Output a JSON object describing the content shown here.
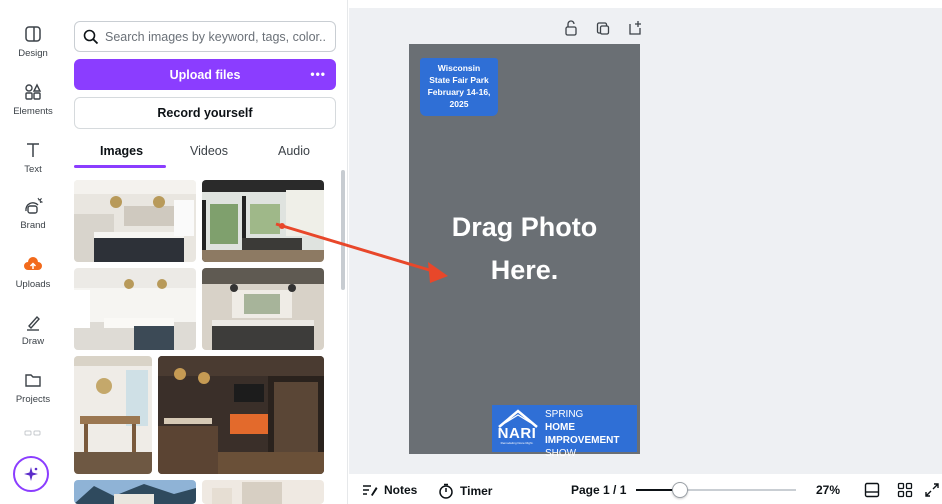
{
  "rail": {
    "items": [
      {
        "label": "Design",
        "icon": "design-icon"
      },
      {
        "label": "Elements",
        "icon": "elements-icon"
      },
      {
        "label": "Text",
        "icon": "text-icon"
      },
      {
        "label": "Brand",
        "icon": "brand-icon"
      },
      {
        "label": "Uploads",
        "icon": "uploads-icon"
      },
      {
        "label": "Draw",
        "icon": "draw-icon"
      },
      {
        "label": "Projects",
        "icon": "projects-icon"
      }
    ]
  },
  "panel": {
    "search_placeholder": "Search images by keyword, tags, color...",
    "upload_label": "Upload files",
    "upload_more": "•••",
    "record_label": "Record yourself",
    "tabs": [
      {
        "label": "Images",
        "active": true
      },
      {
        "label": "Videos",
        "active": false
      },
      {
        "label": "Audio",
        "active": false
      }
    ]
  },
  "canvas": {
    "badge_lines": [
      "Wisconsin",
      "State Fair Park",
      "February 14-16,",
      "2025"
    ],
    "placeholder_lines": [
      "Drag Photo",
      "Here."
    ],
    "logo_word": "NARI",
    "logo_sub": "Remodeling Done Right.",
    "show_lines": [
      {
        "light": "SPRING ",
        "bold": "HOME"
      },
      {
        "light": "",
        "bold": "IMPROVEMENT"
      },
      {
        "light": "SHOW",
        "bold": ""
      }
    ]
  },
  "bottom": {
    "notes_label": "Notes",
    "timer_label": "Timer",
    "page_label": "Page 1 / 1",
    "zoom": "27%",
    "zoom_fraction": 0.27
  },
  "colors": {
    "accent": "#8b3dff",
    "brand_blue": "#2f6fd6",
    "page_gray": "#6a6f74",
    "arrow": "#e8472a"
  }
}
